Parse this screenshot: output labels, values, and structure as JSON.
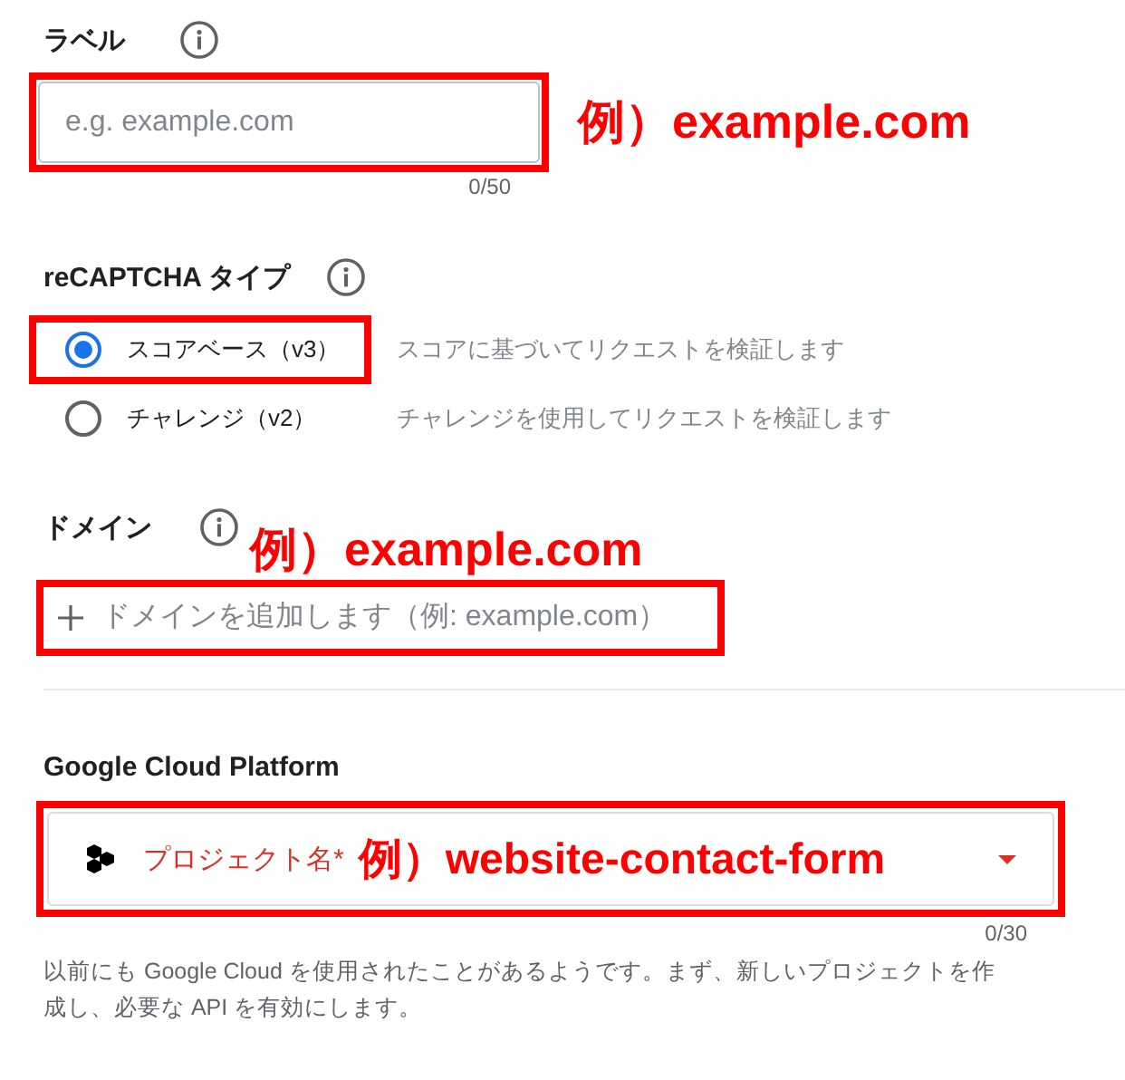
{
  "label_field": {
    "label": "ラベル",
    "placeholder": "e.g. example.com",
    "counter": "0/50",
    "highlighted": true,
    "annotation": "例）example.com"
  },
  "recaptcha_type": {
    "label": "reCAPTCHA タイプ",
    "options": [
      {
        "label": "スコアベース（v3）",
        "description": "スコアに基づいてリクエストを検証します",
        "selected": true,
        "highlighted": true
      },
      {
        "label": "チャレンジ（v2）",
        "description": "チャレンジを使用してリクエストを検証します",
        "selected": false,
        "highlighted": false
      }
    ]
  },
  "domain": {
    "label": "ドメイン",
    "annotation": "例）example.com",
    "placeholder": "ドメインを追加します（例: example.com）",
    "highlighted": true
  },
  "gcp": {
    "heading": "Google Cloud Platform",
    "project_label": "プロジェクト名*",
    "annotation": "例）website-contact-form",
    "highlighted": true,
    "counter": "0/30",
    "help_text": "以前にも Google Cloud を使用されたことがあるようです。まず、新しいプロジェクトを作成し、必要な API を有効にします。"
  }
}
